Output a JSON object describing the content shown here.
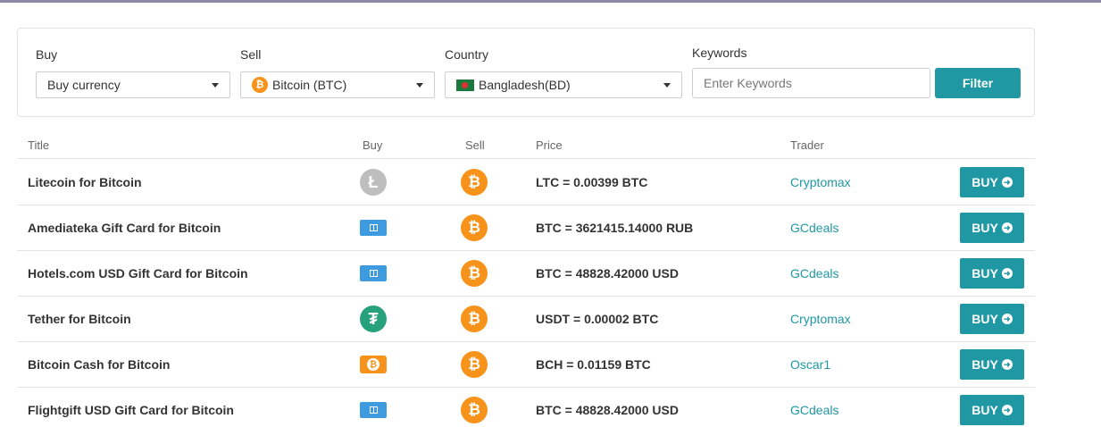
{
  "filters": {
    "buy": {
      "label": "Buy",
      "value": "Buy currency"
    },
    "sell": {
      "label": "Sell",
      "value": "Bitcoin (BTC)",
      "icon": "bitcoin-icon"
    },
    "country": {
      "label": "Country",
      "value": "Bangladesh(BD)",
      "icon": "bangladesh-flag-icon"
    },
    "keywords": {
      "label": "Keywords",
      "placeholder": "Enter Keywords"
    },
    "filter_button": "Filter"
  },
  "table": {
    "headers": {
      "title": "Title",
      "buy": "Buy",
      "sell": "Sell",
      "price": "Price",
      "trader": "Trader"
    },
    "rows": [
      {
        "title": "Litecoin for Bitcoin",
        "buy_icon": "litecoin-icon",
        "sell_icon": "bitcoin-icon",
        "price": "LTC = 0.00399 BTC",
        "trader": "Cryptomax",
        "button": "BUY"
      },
      {
        "title": "Amediateka Gift Card for Bitcoin",
        "buy_icon": "gift-card-icon",
        "sell_icon": "bitcoin-icon",
        "price": "BTC = 3621415.14000 RUB",
        "trader": "GCdeals",
        "button": "BUY"
      },
      {
        "title": "Hotels.com USD Gift Card for Bitcoin",
        "buy_icon": "gift-card-icon",
        "sell_icon": "bitcoin-icon",
        "price": "BTC = 48828.42000 USD",
        "trader": "GCdeals",
        "button": "BUY"
      },
      {
        "title": "Tether for Bitcoin",
        "buy_icon": "tether-icon",
        "sell_icon": "bitcoin-icon",
        "price": "USDT = 0.00002 BTC",
        "trader": "Cryptomax",
        "button": "BUY"
      },
      {
        "title": "Bitcoin Cash for Bitcoin",
        "buy_icon": "bitcoin-cash-icon",
        "sell_icon": "bitcoin-icon",
        "price": "BCH = 0.01159 BTC",
        "trader": "Oscar1",
        "button": "BUY"
      },
      {
        "title": "Flightgift USD Gift Card for Bitcoin",
        "buy_icon": "gift-card-icon",
        "sell_icon": "bitcoin-icon",
        "price": "BTC = 48828.42000 USD",
        "trader": "GCdeals",
        "button": "BUY"
      }
    ]
  },
  "colors": {
    "accent": "#1f98a4",
    "bitcoin": "#f7931a",
    "tether": "#26a17b",
    "litecoin": "#bebebe",
    "gift_card": "#3e9be0"
  }
}
